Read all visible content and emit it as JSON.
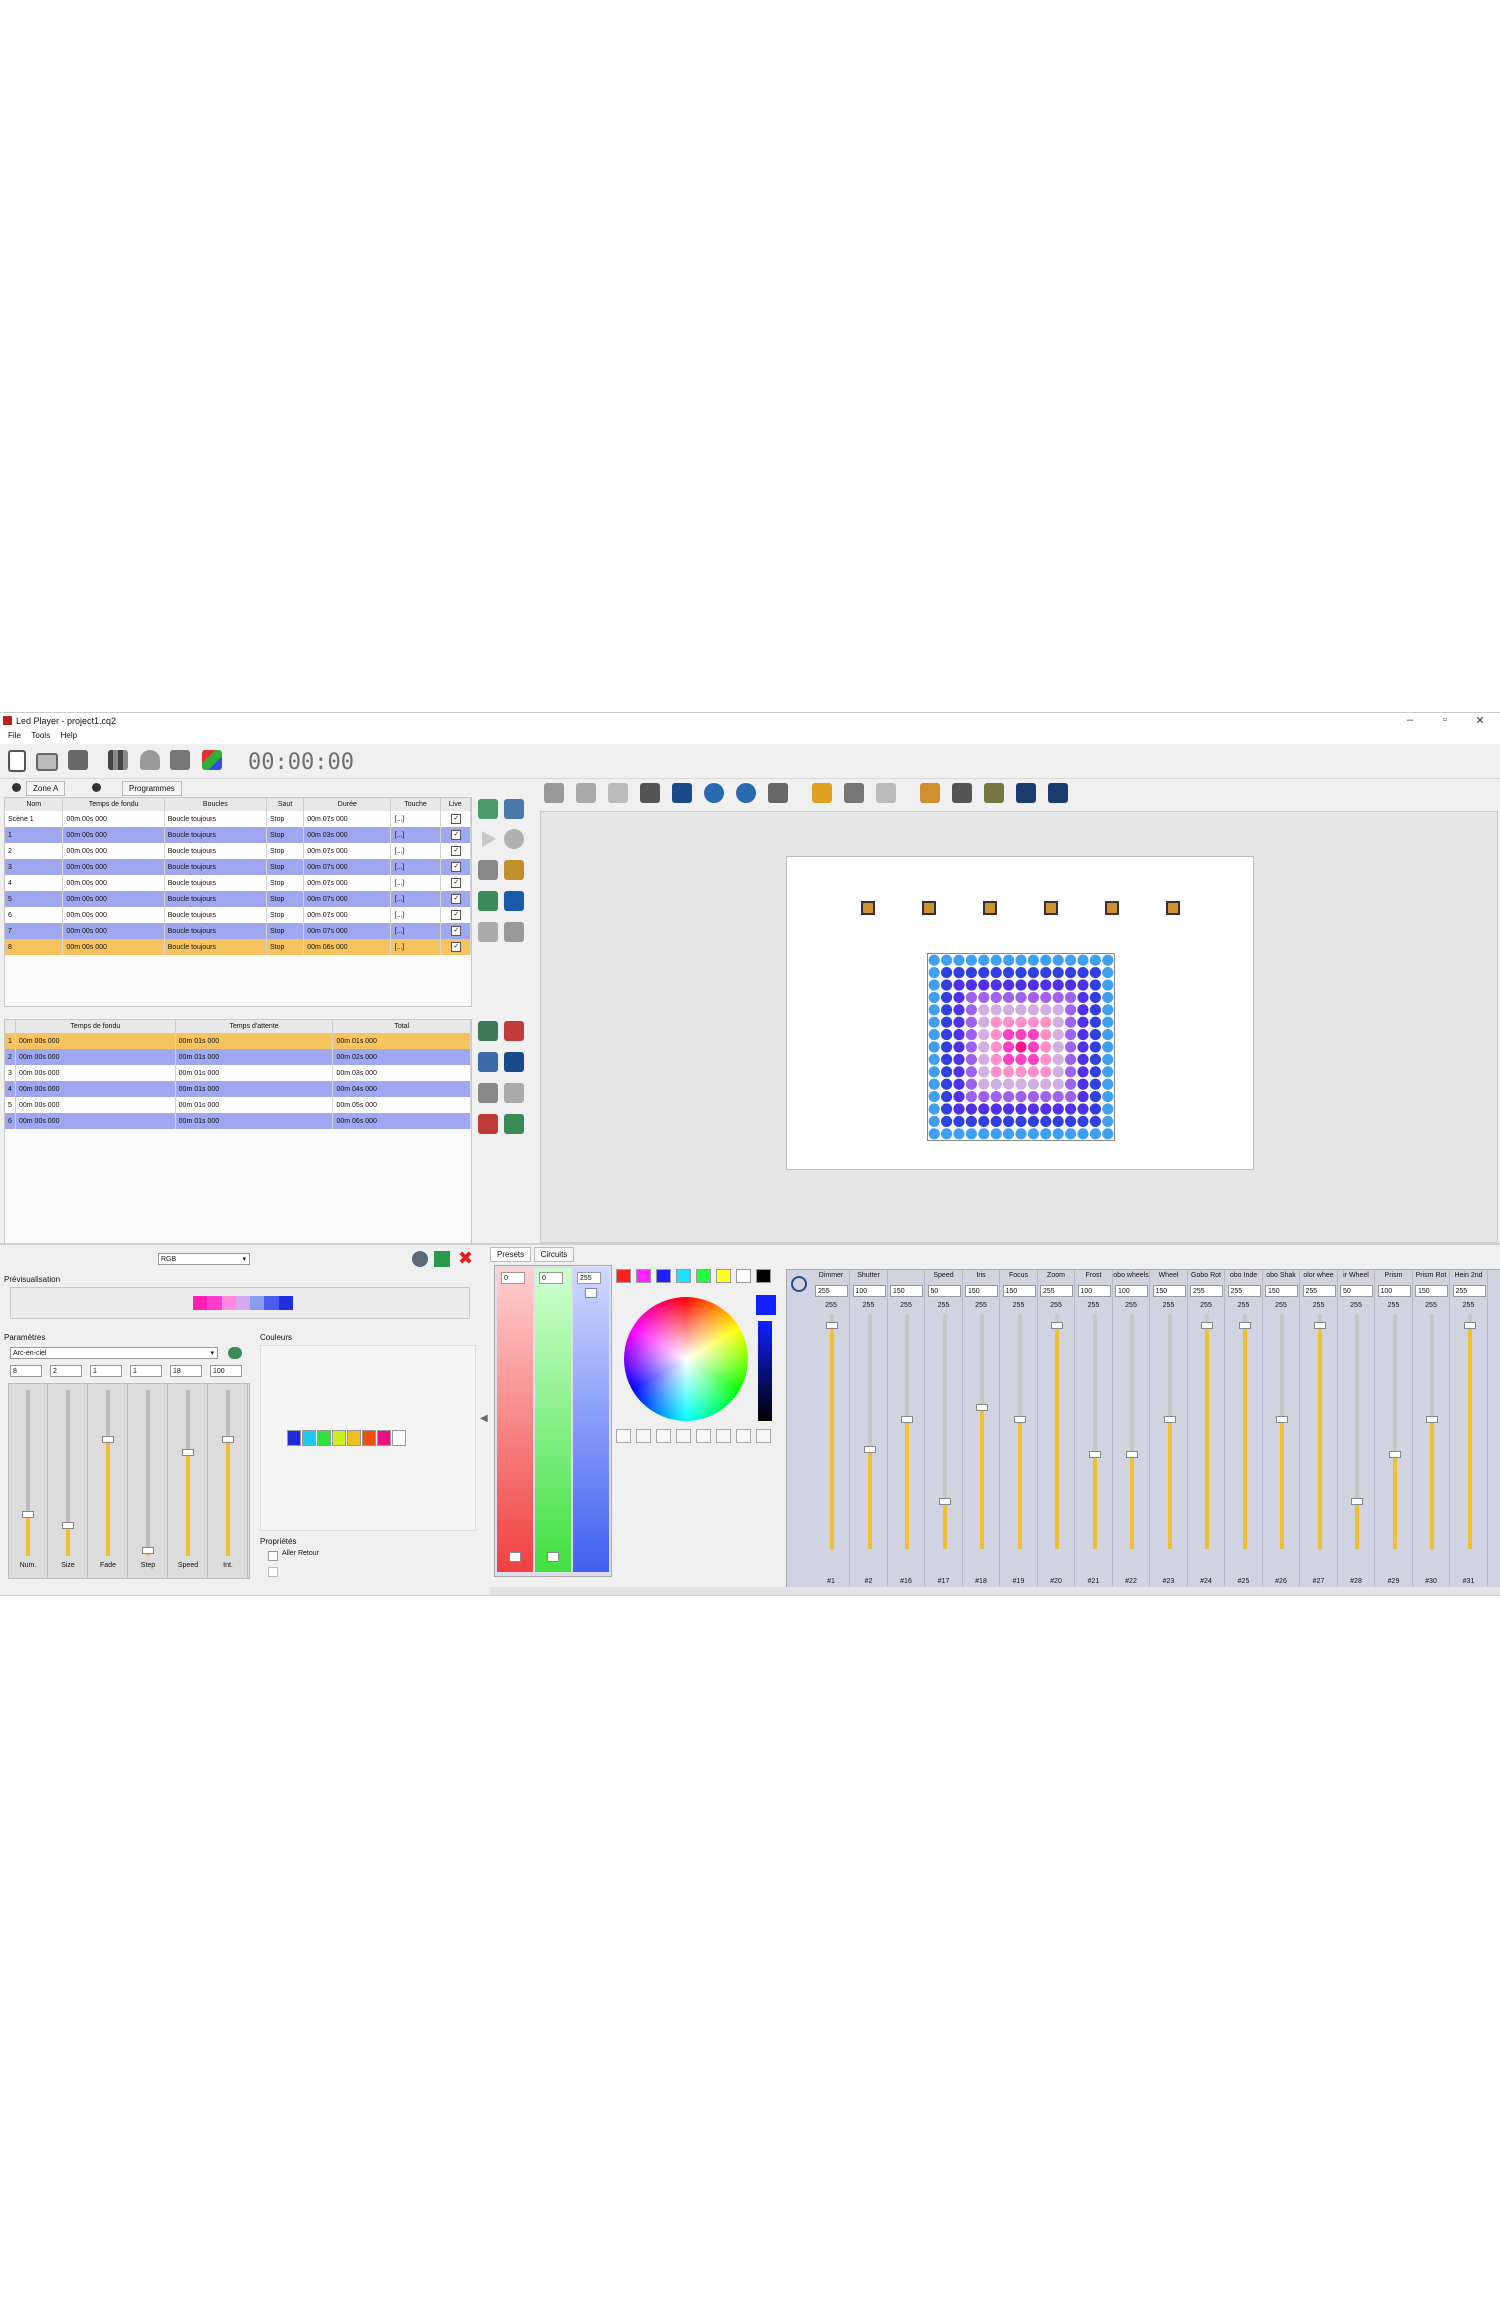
{
  "window": {
    "title": "Led Player - project1.cq2",
    "menu": [
      "File",
      "Tools",
      "Help"
    ],
    "controls": [
      "–",
      "▫",
      "✕"
    ]
  },
  "toolbar": {
    "time": "00:00:00",
    "icons": [
      "new-icon",
      "open-icon",
      "save-icon",
      "bars-icon",
      "shield-icon",
      "camera-icon",
      "cube-icon"
    ]
  },
  "zone_tabs": [
    {
      "label": "Zone A"
    },
    {
      "label": "Programmes"
    }
  ],
  "scene_table": {
    "headers": [
      "Nom",
      "Temps de fondu",
      "Boucles",
      "Saut",
      "Durée",
      "Touche",
      "Live"
    ],
    "rows": [
      {
        "nom": "Scène 1",
        "fondu": "00m 00s 000",
        "boucles": "Boucle toujours",
        "saut": "Stop",
        "duree": "00m 07s 000",
        "touche": "[...]",
        "live": "✓",
        "style": "white"
      },
      {
        "nom": "1",
        "fondu": "00m 00s 000",
        "boucles": "Boucle toujours",
        "saut": "Stop",
        "duree": "00m 03s 000",
        "touche": "[...]",
        "live": "✓",
        "style": "blue"
      },
      {
        "nom": "2",
        "fondu": "00m 00s 000",
        "boucles": "Boucle toujours",
        "saut": "Stop",
        "duree": "00m 07s 000",
        "touche": "[...]",
        "live": "✓",
        "style": "white"
      },
      {
        "nom": "3",
        "fondu": "00m 00s 000",
        "boucles": "Boucle toujours",
        "saut": "Stop",
        "duree": "00m 07s 000",
        "touche": "[...]",
        "live": "✓",
        "style": "blue"
      },
      {
        "nom": "4",
        "fondu": "00m 00s 000",
        "boucles": "Boucle toujours",
        "saut": "Stop",
        "duree": "00m 07s 000",
        "touche": "[...]",
        "live": "✓",
        "style": "white"
      },
      {
        "nom": "5",
        "fondu": "00m 00s 000",
        "boucles": "Boucle toujours",
        "saut": "Stop",
        "duree": "00m 07s 000",
        "touche": "[...]",
        "live": "✓",
        "style": "blue"
      },
      {
        "nom": "6",
        "fondu": "00m 00s 000",
        "boucles": "Boucle toujours",
        "saut": "Stop",
        "duree": "00m 07s 000",
        "touche": "[...]",
        "live": "✓",
        "style": "white"
      },
      {
        "nom": "7",
        "fondu": "00m 00s 000",
        "boucles": "Boucle toujours",
        "saut": "Stop",
        "duree": "00m 07s 000",
        "touche": "[...]",
        "live": "✓",
        "style": "blue"
      },
      {
        "nom": "8",
        "fondu": "00m 00s 000",
        "boucles": "Boucle toujours",
        "saut": "Stop",
        "duree": "00m 06s 000",
        "touche": "[...]",
        "live": "✓",
        "style": "orange"
      }
    ]
  },
  "step_table": {
    "headers": [
      "Temps de fondu",
      "Temps d'attente",
      "Total"
    ],
    "rows": [
      {
        "n": "1",
        "fondu": "00m 00s 000",
        "attente": "00m 01s 000",
        "total": "00m 01s 000",
        "style": "orange"
      },
      {
        "n": "2",
        "fondu": "00m 00s 000",
        "attente": "00m 01s 000",
        "total": "00m 02s 000",
        "style": "blue"
      },
      {
        "n": "3",
        "fondu": "00m 00s 000",
        "attente": "00m 01s 000",
        "total": "00m 03s 000",
        "style": "white"
      },
      {
        "n": "4",
        "fondu": "00m 00s 000",
        "attente": "00m 01s 000",
        "total": "00m 04s 000",
        "style": "blue"
      },
      {
        "n": "5",
        "fondu": "00m 00s 000",
        "attente": "00m 01s 000",
        "total": "00m 05s 000",
        "style": "white"
      },
      {
        "n": "6",
        "fondu": "00m 00s 000",
        "attente": "00m 01s 000",
        "total": "00m 06s 000",
        "style": "blue"
      }
    ]
  },
  "effect": {
    "mode": "RGB",
    "preview_label": "Prévisualisation",
    "params_label": "Paramètres",
    "colors_label": "Couleurs",
    "props_label": "Propriétés",
    "effect_name": "Arc-en-ciel",
    "param_values": [
      "8",
      "2",
      "1",
      "1",
      "18",
      "100"
    ],
    "fader_labels": [
      "Num.",
      "Size",
      "Fade",
      "Step",
      "Speed",
      "Int."
    ],
    "fader_levels": [
      0.25,
      0.18,
      0.7,
      0.03,
      0.62,
      0.7
    ],
    "aller_retour": "Aller Retour",
    "preview_colors": [
      "#ff1fb4",
      "#ff3cd0",
      "#ff8ae0",
      "#d5a8f0",
      "#8b9cf0",
      "#4a5cf0",
      "#2030e0"
    ],
    "palette": [
      "#1e2bd6",
      "#1ec8f0",
      "#2ee040",
      "#c8f020",
      "#f0c020",
      "#f05010",
      "#f01080",
      "#ffffff"
    ]
  },
  "presets": {
    "tabs": [
      "Presets",
      "Circuits"
    ],
    "rgb_values": [
      "0",
      "0",
      "255"
    ],
    "swatches": [
      "#ff2020",
      "#ff20ff",
      "#2020ff",
      "#20e0ff",
      "#20ff40",
      "#ffff20",
      "#ffffff",
      "#000000"
    ]
  },
  "faders": [
    {
      "name": "Dimmer",
      "val": "255",
      "top": "255",
      "level": 0.95,
      "foot": "#1"
    },
    {
      "name": "Shutter",
      "val": "100",
      "top": "255",
      "level": 0.42,
      "foot": "#2"
    },
    {
      "name": "",
      "val": "150",
      "top": "255",
      "level": 0.55,
      "foot": "#16"
    },
    {
      "name": "Speed",
      "val": "50",
      "top": "255",
      "level": 0.2,
      "foot": "#17"
    },
    {
      "name": "Iris",
      "val": "150",
      "top": "255",
      "level": 0.6,
      "foot": "#18"
    },
    {
      "name": "Focus",
      "val": "150",
      "top": "255",
      "level": 0.55,
      "foot": "#19"
    },
    {
      "name": "Zoom",
      "val": "255",
      "top": "255",
      "level": 0.95,
      "foot": "#20"
    },
    {
      "name": "Frost",
      "val": "100",
      "top": "255",
      "level": 0.4,
      "foot": "#21"
    },
    {
      "name": "obo wheels",
      "val": "100",
      "top": "255",
      "level": 0.4,
      "foot": "#22"
    },
    {
      "name": "Wheel",
      "val": "150",
      "top": "255",
      "level": 0.55,
      "foot": "#23"
    },
    {
      "name": "Gobo Rot",
      "val": "255",
      "top": "255",
      "level": 0.95,
      "foot": "#24"
    },
    {
      "name": "obo Inde",
      "val": "255",
      "top": "255",
      "level": 0.95,
      "foot": "#25"
    },
    {
      "name": "obo Shak",
      "val": "150",
      "top": "255",
      "level": 0.55,
      "foot": "#26"
    },
    {
      "name": "olor whee",
      "val": "255",
      "top": "255",
      "level": 0.95,
      "foot": "#27"
    },
    {
      "name": "ir Wheel",
      "val": "50",
      "top": "255",
      "level": 0.2,
      "foot": "#28"
    },
    {
      "name": "Prism",
      "val": "100",
      "top": "255",
      "level": 0.4,
      "foot": "#29"
    },
    {
      "name": "Prism Rot",
      "val": "150",
      "top": "255",
      "level": 0.55,
      "foot": "#30"
    },
    {
      "name": "Hein 2nd",
      "val": "255",
      "top": "255",
      "level": 0.95,
      "foot": "#31"
    }
  ]
}
